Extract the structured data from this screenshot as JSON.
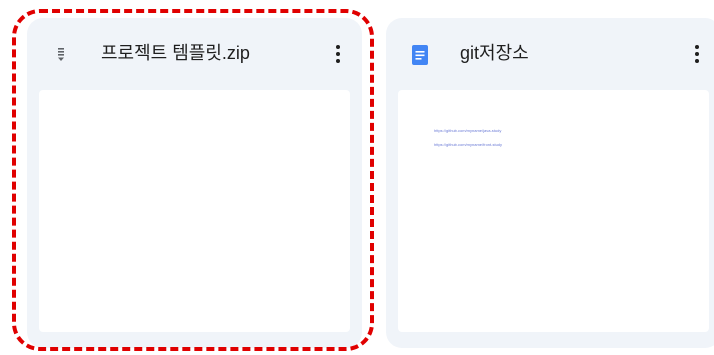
{
  "cards": {
    "zip": {
      "title": "프로젝트 템플릿.zip",
      "icon": "zip-file-icon"
    },
    "doc": {
      "title": "git저장소",
      "icon": "google-docs-icon",
      "icon_color": "#4285f4",
      "preview_lines": [
        "https://github.com/myname/java-study",
        "https://github.com/myname/front-study"
      ]
    }
  },
  "colors": {
    "card_bg": "#f0f4f9",
    "highlight": "#e00000"
  }
}
